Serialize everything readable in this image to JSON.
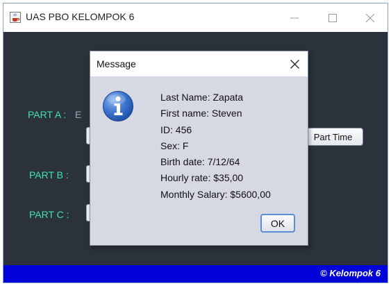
{
  "window": {
    "title": "UAS PBO KELOMPOK 6",
    "icon": "java-cup-icon",
    "controls": [
      "minimize-icon",
      "maximize-icon",
      "close-icon"
    ]
  },
  "main": {
    "part_a_label": "PART A :",
    "part_a_peek": "E",
    "part_b_label": "PART B :",
    "part_c_label": "PART C :",
    "part_time_button": "Part Time"
  },
  "footer": {
    "text": "© Kelompok 6"
  },
  "dialog": {
    "title": "Message",
    "icon": "info-icon",
    "lines": [
      "Last Name: Zapata",
      "First name: Steven",
      "ID: 456",
      "Sex: F",
      "Birth date: 7/12/64",
      "Hourly rate: $35,00",
      "Monthly Salary: $5600,00"
    ],
    "ok_button": "OK"
  },
  "colors": {
    "background": "#2b323b",
    "label_accent": "#3fe3b0",
    "footer": "#0000d8",
    "dialog_bg": "#d6d8e4",
    "info_icon": "#2f6fd0"
  }
}
